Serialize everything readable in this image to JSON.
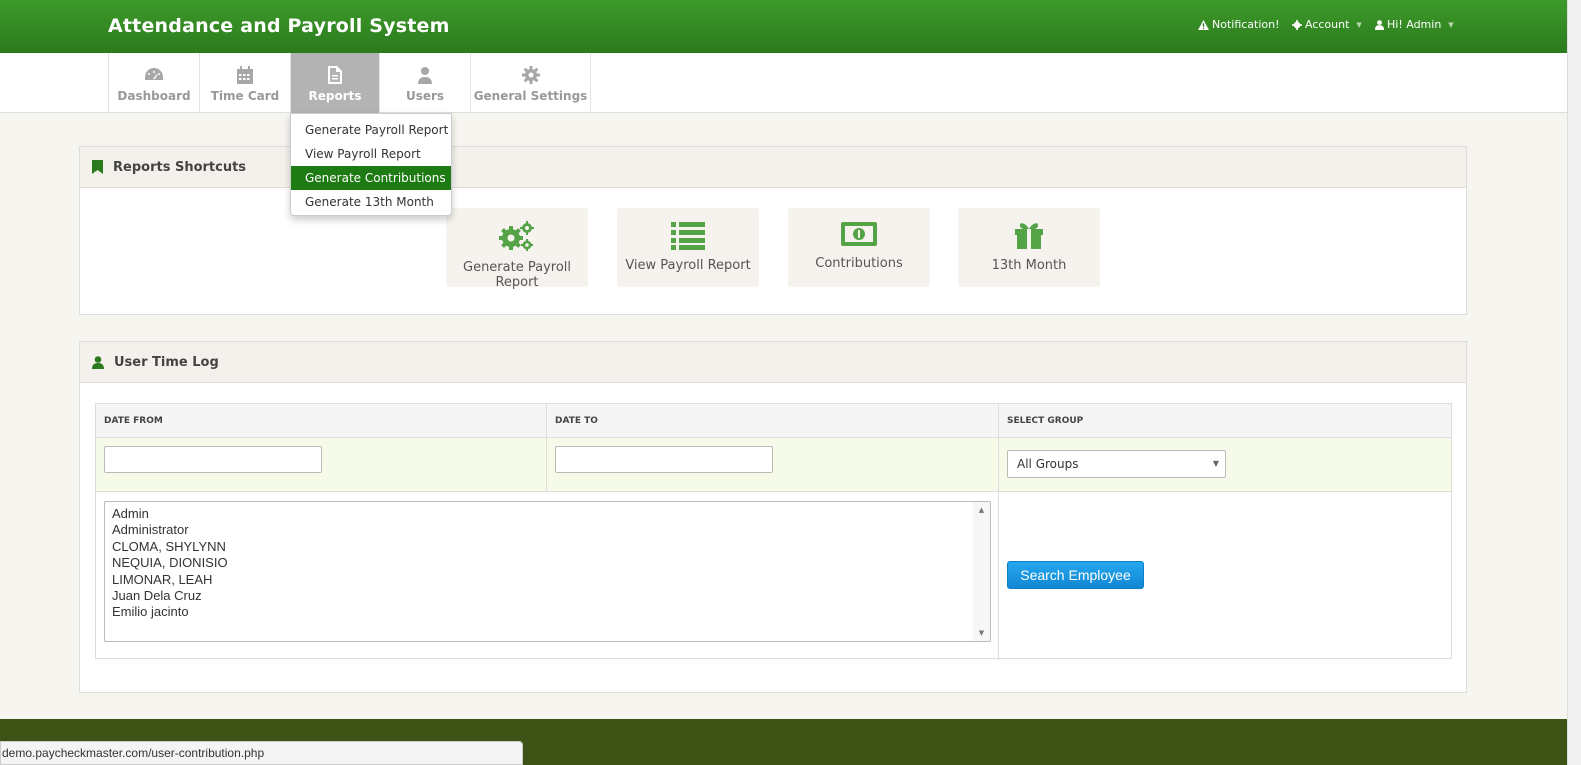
{
  "header": {
    "title": "Attendance and Payroll System",
    "notification_label": "Notification!",
    "account_label": "Account",
    "user_label": "Hi! Admin"
  },
  "tabs": [
    {
      "label": "Dashboard",
      "icon": "dashboard-icon"
    },
    {
      "label": "Time Card",
      "icon": "calendar-icon"
    },
    {
      "label": "Reports",
      "icon": "document-icon",
      "active": true
    },
    {
      "label": "Users",
      "icon": "users-icon"
    },
    {
      "label": "General Settings",
      "icon": "gear-icon"
    }
  ],
  "reports_menu": {
    "items": [
      "Generate Payroll Report",
      "View Payroll Report",
      "Generate Contributions",
      "Generate 13th Month"
    ],
    "highlighted": "Generate Contributions"
  },
  "shortcuts_panel": {
    "title": "Reports Shortcuts",
    "items": [
      {
        "label": "Generate Payroll Report",
        "icon": "gears-icon"
      },
      {
        "label": "View Payroll Report",
        "icon": "list-icon"
      },
      {
        "label": "Contributions",
        "icon": "money-icon"
      },
      {
        "label": "13th Month",
        "icon": "gift-icon"
      }
    ]
  },
  "time_log_panel": {
    "title": "User Time Log",
    "headers": {
      "date_from": "DATE FROM",
      "date_to": "DATE TO",
      "select_group": "SELECT GROUP"
    },
    "date_from_value": "",
    "date_to_value": "",
    "group_selected": "All Groups",
    "employees": [
      "Admin",
      "Administrator",
      "CLOMA, SHYLYNN",
      "NEQUIA, DIONISIO",
      "LIMONAR, LEAH",
      "Juan Dela Cruz",
      "Emilio jacinto"
    ],
    "search_button": "Search Employee"
  },
  "status_url": "demo.paycheckmaster.com/user-contribution.php",
  "colors": {
    "brand_green": "#2b7a1d",
    "highlight_green": "#1e7a12",
    "button_blue": "#1287d4",
    "footer": "#3d5316"
  }
}
